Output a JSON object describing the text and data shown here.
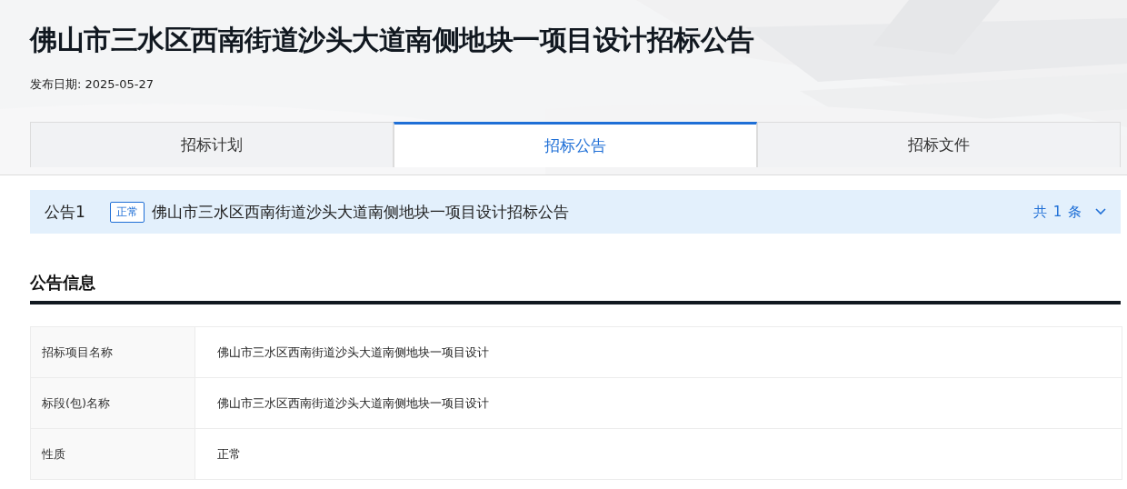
{
  "header": {
    "title": "佛山市三水区西南街道沙头大道南侧地块一项目设计招标公告",
    "date_label": "发布日期: 2025-05-27"
  },
  "tabs": [
    {
      "label": "招标计划",
      "selected": false
    },
    {
      "label": "招标公告",
      "selected": true
    },
    {
      "label": "招标文件",
      "selected": false
    }
  ],
  "notice_bar": {
    "label": "公告1",
    "badge": "正常",
    "title": "佛山市三水区西南街道沙头大道南侧地块一项目设计招标公告",
    "count": "共 1 条",
    "expanded": false
  },
  "section": {
    "heading": "公告信息"
  },
  "info_table": {
    "rows": [
      {
        "label": "招标项目名称",
        "value": "佛山市三水区西南街道沙头大道南侧地块一项目设计"
      },
      {
        "label": "标段(包)名称",
        "value": "佛山市三水区西南街道沙头大道南侧地块一项目设计"
      },
      {
        "label": "性质",
        "value": "正常"
      }
    ]
  }
}
